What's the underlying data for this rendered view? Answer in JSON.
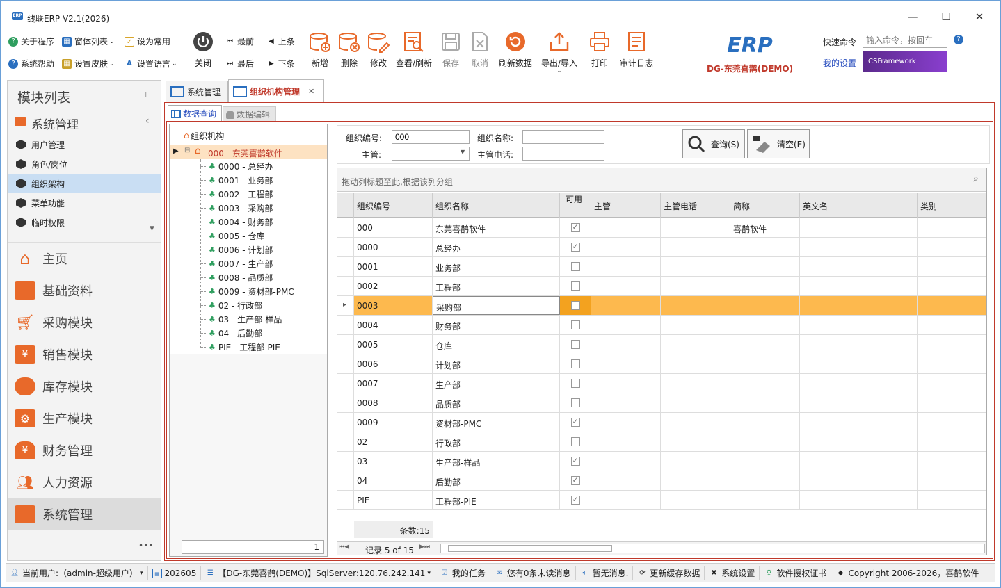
{
  "window": {
    "title": "线联ERP V2.1(2026)",
    "minimize": "—",
    "maximize": "☐",
    "close": "✕",
    "logo_badge": "ERP"
  },
  "toolbar": {
    "small_left": [
      {
        "label": "关于程序",
        "icon": "info-icon",
        "color": "#2e9e5e"
      },
      {
        "label": "系统帮助",
        "icon": "help-icon",
        "color": "#2a6fbf"
      }
    ],
    "small_mid": [
      {
        "label": "窗体列表",
        "icon": "window-list-icon",
        "color": "#2a6fbf",
        "dropdown": true
      },
      {
        "label": "设置皮肤",
        "icon": "skin-icon",
        "color": "#c8a02a",
        "dropdown": true
      }
    ],
    "small_right": [
      {
        "label": "设为常用",
        "icon": "favorite-icon",
        "color": "#d9a52a"
      },
      {
        "label": "设置语言",
        "icon": "language-icon",
        "color": "#2a6fbf",
        "dropdown": true
      }
    ],
    "close_label": "关闭",
    "nav": {
      "first": "最前",
      "prev": "上条",
      "last": "最后",
      "next": "下条"
    },
    "big_buttons": [
      {
        "label": "新增",
        "icon": "add-icon",
        "color": "#e8692a",
        "enabled": true
      },
      {
        "label": "删除",
        "icon": "delete-icon",
        "color": "#e8692a",
        "enabled": true
      },
      {
        "label": "修改",
        "icon": "edit-icon",
        "color": "#e8692a",
        "enabled": true
      },
      {
        "label": "查看/刷新",
        "icon": "view-refresh-icon",
        "color": "#e8692a",
        "enabled": true
      },
      {
        "label": "保存",
        "icon": "save-icon",
        "color": "#aaaaaa",
        "enabled": false
      },
      {
        "label": "取消",
        "icon": "cancel-icon",
        "color": "#aaaaaa",
        "enabled": false
      },
      {
        "label": "刷新数据",
        "icon": "refresh-data-icon",
        "color": "#e8692a",
        "enabled": true
      },
      {
        "label": "导出/导入",
        "icon": "export-import-icon",
        "color": "#e8692a",
        "enabled": true
      },
      {
        "label": "打印",
        "icon": "print-icon",
        "color": "#e8692a",
        "enabled": true
      },
      {
        "label": "审计日志",
        "icon": "audit-log-icon",
        "color": "#e8692a",
        "enabled": true
      }
    ],
    "brand_logo": "ERP",
    "brand_name": "DG-东莞喜鹊(DEMO)",
    "quick_cmd_label": "快速命令",
    "quick_cmd_placeholder": "输入命令，按回车",
    "my_settings": "我的设置",
    "banner": "CSFramework"
  },
  "left_panel": {
    "title": "模块列表",
    "pin_icon": "pin-icon",
    "group_title": "系统管理",
    "sub_items": [
      {
        "label": "用户管理",
        "selected": false
      },
      {
        "label": "角色/岗位",
        "selected": false
      },
      {
        "label": "组织架构",
        "selected": true
      },
      {
        "label": "菜单功能",
        "selected": false
      },
      {
        "label": "临时权限",
        "selected": false
      }
    ],
    "modules": [
      {
        "label": "主页",
        "icon": "home-icon",
        "selected": false
      },
      {
        "label": "基础资料",
        "icon": "folder-icon",
        "selected": false
      },
      {
        "label": "采购模块",
        "icon": "cart-icon",
        "selected": false
      },
      {
        "label": "销售模块",
        "icon": "sales-bag-icon",
        "selected": false
      },
      {
        "label": "库存模块",
        "icon": "warehouse-icon",
        "selected": false
      },
      {
        "label": "生产模块",
        "icon": "gears-icon",
        "selected": false
      },
      {
        "label": "财务管理",
        "icon": "money-bag-icon",
        "selected": false
      },
      {
        "label": "人力资源",
        "icon": "people-icon",
        "selected": false
      },
      {
        "label": "系统管理",
        "icon": "system-icon",
        "selected": true
      }
    ],
    "more": "•••"
  },
  "doc_tabs": [
    {
      "label": "系统管理",
      "active": false
    },
    {
      "label": "组织机构管理",
      "active": true,
      "closable": true
    }
  ],
  "sub_tabs": [
    {
      "label": "数据查询",
      "active": true
    },
    {
      "label": "数据编辑",
      "active": false
    }
  ],
  "tree": {
    "root": "组织机构",
    "company": "000 - 东莞喜鹊软件",
    "nodes": [
      "0000 - 总经办",
      "0001 - 业务部",
      "0002 - 工程部",
      "0003 - 采购部",
      "0004 - 财务部",
      "0005 - 仓库",
      "0006 - 计划部",
      "0007 - 生产部",
      "0008 - 品质部",
      "0009 - 资材部-PMC",
      "02 - 行政部",
      "03 - 生产部-样品",
      "04 - 后勤部",
      "PIE - 工程部-PIE"
    ],
    "footer_value": "1"
  },
  "search": {
    "code_label": "组织编号:",
    "code_value": "000",
    "name_label": "组织名称:",
    "name_value": "",
    "manager_label": "主管:",
    "manager_value": "",
    "phone_label": "主管电话:",
    "phone_value": "",
    "query_btn": "查询(S)",
    "clear_btn": "清空(E)"
  },
  "grid": {
    "group_hint": "拖动列标题至此,根据该列分组",
    "columns": [
      "组织编号",
      "组织名称",
      "可用",
      "主管",
      "主管电话",
      "简称",
      "英文名",
      "类别"
    ],
    "rows": [
      {
        "code": "000",
        "name": "东莞喜鹊软件",
        "enabled": true,
        "short": "喜鹊软件"
      },
      {
        "code": "0000",
        "name": "总经办",
        "enabled": true,
        "short": ""
      },
      {
        "code": "0001",
        "name": "业务部",
        "enabled": false,
        "short": ""
      },
      {
        "code": "0002",
        "name": "工程部",
        "enabled": false,
        "short": ""
      },
      {
        "code": "0003",
        "name": "采购部",
        "enabled": false,
        "short": "",
        "selected": true
      },
      {
        "code": "0004",
        "name": "财务部",
        "enabled": false,
        "short": ""
      },
      {
        "code": "0005",
        "name": "仓库",
        "enabled": false,
        "short": ""
      },
      {
        "code": "0006",
        "name": "计划部",
        "enabled": false,
        "short": ""
      },
      {
        "code": "0007",
        "name": "生产部",
        "enabled": false,
        "short": ""
      },
      {
        "code": "0008",
        "name": "品质部",
        "enabled": false,
        "short": ""
      },
      {
        "code": "0009",
        "name": "资材部-PMC",
        "enabled": true,
        "short": ""
      },
      {
        "code": "02",
        "name": "行政部",
        "enabled": false,
        "short": ""
      },
      {
        "code": "03",
        "name": "生产部-样品",
        "enabled": true,
        "short": ""
      },
      {
        "code": "04",
        "name": "后勤部",
        "enabled": true,
        "short": ""
      },
      {
        "code": "PIE",
        "name": "工程部-PIE",
        "enabled": true,
        "short": ""
      }
    ],
    "count_text": "条数:15",
    "nav_text": "记录 5 of 15"
  },
  "status": {
    "user": "当前用户:（admin-超级用户）",
    "period": "202605",
    "db": "【DG-东莞喜鹊(DEMO)】SqlServer:120.76.242.141",
    "tasks": "我的任务",
    "messages": "您有0条未读消息",
    "notice": "暂无消息.",
    "cache": "更新缓存数据",
    "settings": "系统设置",
    "license": "软件授权证书",
    "copyright": "Copyright 2006-2026，喜鹊软件"
  },
  "colors": {
    "accent_orange": "#fdb94e",
    "tab_red": "#c0392b",
    "header_bg": "#e9e9e9",
    "brand_blue": "#2a6fbf"
  }
}
